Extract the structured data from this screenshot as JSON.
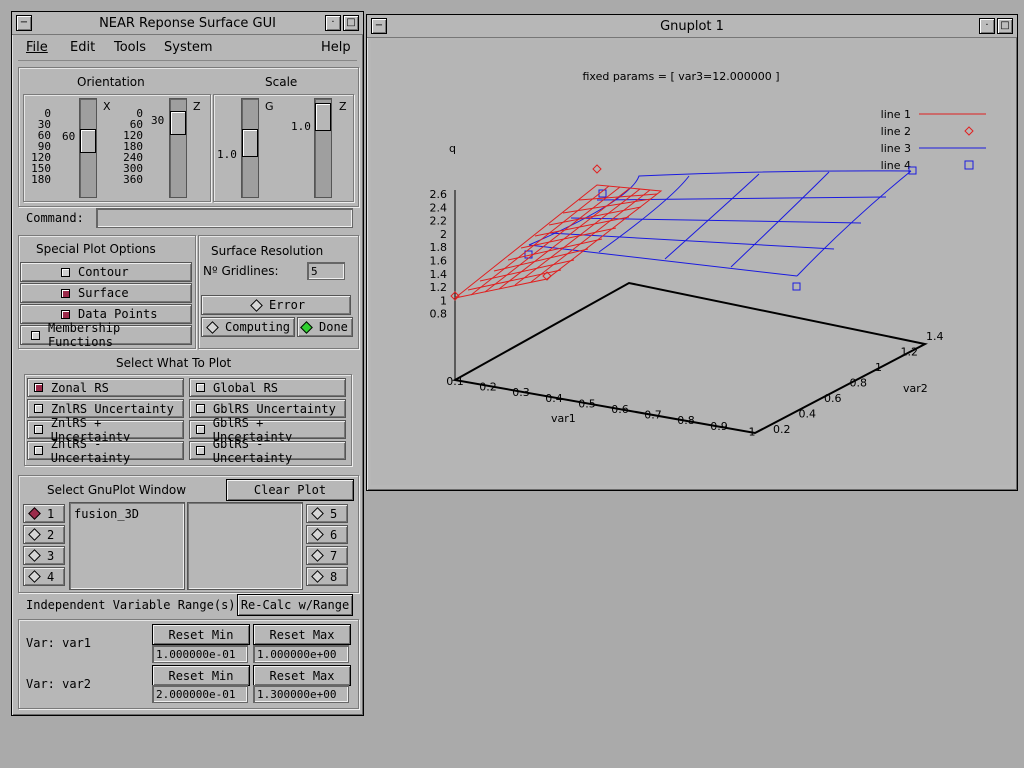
{
  "rs_window": {
    "title": "NEAR Reponse Surface GUI",
    "menu": {
      "file": "File",
      "edit": "Edit",
      "tools": "Tools",
      "system": "System",
      "help": "Help"
    },
    "orientation": {
      "heading": "Orientation",
      "x_axis_label": "X",
      "z_axis_label": "Z",
      "x_ticks": [
        "0",
        "30",
        "60",
        "90",
        "120",
        "150",
        "180"
      ],
      "z_ticks": [
        "0",
        "60",
        "120",
        "180",
        "240",
        "300",
        "360"
      ],
      "x_value": "60",
      "z_value": "30"
    },
    "scale": {
      "heading": "Scale",
      "g_label": "G",
      "z_label": "Z",
      "g_value": "1.0",
      "z_value": "1.0"
    },
    "command": {
      "label": "Command:",
      "value": ""
    },
    "special_plot": {
      "heading": "Special Plot Options",
      "contour": {
        "label": "Contour",
        "checked": false
      },
      "surface": {
        "label": "Surface",
        "checked": true
      },
      "data_points": {
        "label": "Data Points",
        "checked": true
      },
      "membership": {
        "label": "Membership Functions",
        "checked": false
      }
    },
    "surface_resolution": {
      "heading": "Surface Resolution",
      "gridlines_label": "Nº Gridlines:",
      "gridlines_value": "5",
      "error": "Error",
      "computing": "Computing",
      "done": "Done"
    },
    "select_plot": {
      "heading": "Select What To Plot",
      "left": [
        {
          "label": "Zonal RS",
          "checked": true
        },
        {
          "label": "ZnlRS Uncertainty",
          "checked": false
        },
        {
          "label": "ZnlRS + Uncertainty",
          "checked": false
        },
        {
          "label": "ZnlRS - Uncertainty",
          "checked": false
        }
      ],
      "right": [
        {
          "label": "Global RS",
          "checked": false
        },
        {
          "label": "GblRS Uncertainty",
          "checked": false
        },
        {
          "label": "GblRS + Uncertainty",
          "checked": false
        },
        {
          "label": "GblRS - Uncertainty",
          "checked": false
        }
      ]
    },
    "gnuplot_window": {
      "heading": "Select GnuPlot Window",
      "clear_label": "Clear Plot",
      "left_windows": [
        "1",
        "2",
        "3",
        "4"
      ],
      "right_windows": [
        "5",
        "6",
        "7",
        "8"
      ],
      "selected": "1",
      "list_item": "fusion_3D"
    },
    "var_range": {
      "heading": "Independent Variable Range(s)",
      "recalc_label": "Re-Calc w/Range",
      "vars": [
        {
          "label": "Var: var1",
          "reset_min": "Reset Min",
          "reset_max": "Reset Max",
          "min": "1.000000e-01",
          "max": "1.000000e+00"
        },
        {
          "label": "Var: var2",
          "reset_min": "Reset Min",
          "reset_max": "Reset Max",
          "min": "2.000000e-01",
          "max": "1.300000e+00"
        }
      ]
    }
  },
  "gnuplot": {
    "title": "Gnuplot 1",
    "plot_title": "fixed params = [ var3=12.000000 ]",
    "zlabel": "q",
    "xlabel": "var1",
    "ylabel": "var2",
    "legend": [
      {
        "label": "line 1",
        "color": "#e02020",
        "style": "line"
      },
      {
        "label": "line 2",
        "color": "#e02020",
        "style": "diamond"
      },
      {
        "label": "line 3",
        "color": "#1a1ae0",
        "style": "line"
      },
      {
        "label": "line 4",
        "color": "#1a1ae0",
        "style": "square"
      }
    ],
    "z_ticks": [
      "2.6",
      "2.4",
      "2.2",
      "2",
      "1.8",
      "1.6",
      "1.4",
      "1.2",
      "1",
      "0.8"
    ],
    "x_ticks": [
      "0.1",
      "0.2",
      "0.3",
      "0.4",
      "0.5",
      "0.6",
      "0.7",
      "0.8",
      "0.9",
      "1"
    ],
    "y_ticks": [
      "0.2",
      "0.4",
      "0.6",
      "0.8",
      "1",
      "1.2",
      "1.4"
    ]
  },
  "icons": {
    "minimize": "minimize-icon",
    "maximize": "maximize-icon",
    "window_menu": "window-menu-icon"
  }
}
